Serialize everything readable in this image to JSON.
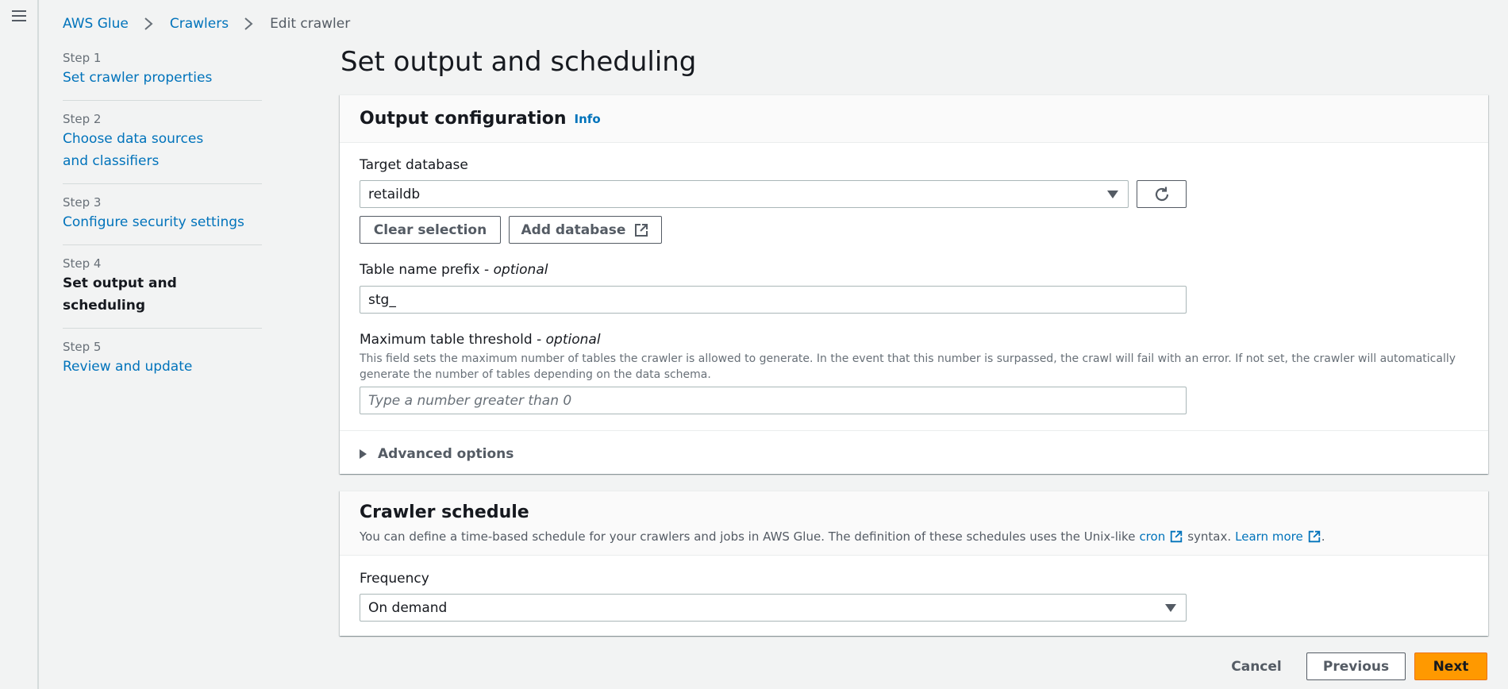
{
  "breadcrumb": {
    "items": [
      "AWS Glue",
      "Crawlers",
      "Edit crawler"
    ]
  },
  "steps": [
    {
      "num": "Step 1",
      "label": "Set crawler properties"
    },
    {
      "num": "Step 2",
      "label": "Choose data sources and classifiers"
    },
    {
      "num": "Step 3",
      "label": "Configure security settings"
    },
    {
      "num": "Step 4",
      "label": "Set output and scheduling"
    },
    {
      "num": "Step 5",
      "label": "Review and update"
    }
  ],
  "page_title": "Set output and scheduling",
  "output": {
    "title": "Output configuration",
    "info": "Info",
    "target_db_label": "Target database",
    "target_db_value": "retaildb",
    "clear_selection": "Clear selection",
    "add_database": "Add database",
    "prefix_label": "Table name prefix -",
    "prefix_optional": "optional",
    "prefix_value": "stg_",
    "threshold_label": "Maximum table threshold -",
    "threshold_optional": "optional",
    "threshold_desc": "This field sets the maximum number of tables the crawler is allowed to generate. In the event that this number is surpassed, the crawl will fail with an error. If not set, the crawler will automatically generate the number of tables depending on the data schema.",
    "threshold_placeholder": "Type a number greater than 0",
    "advanced": "Advanced options"
  },
  "schedule": {
    "title": "Crawler schedule",
    "desc_prefix": "You can define a time-based schedule for your crawlers and jobs in AWS Glue. The definition of these schedules uses the Unix-like",
    "cron_link": "cron",
    "desc_mid": "syntax.",
    "learn_more": "Learn more",
    "desc_end": ".",
    "frequency_label": "Frequency",
    "frequency_value": "On demand"
  },
  "footer": {
    "cancel": "Cancel",
    "previous": "Previous",
    "next": "Next"
  },
  "colors": {
    "link": "#0073bb",
    "primary_button": "#ff9900",
    "background": "#f2f3f3"
  }
}
